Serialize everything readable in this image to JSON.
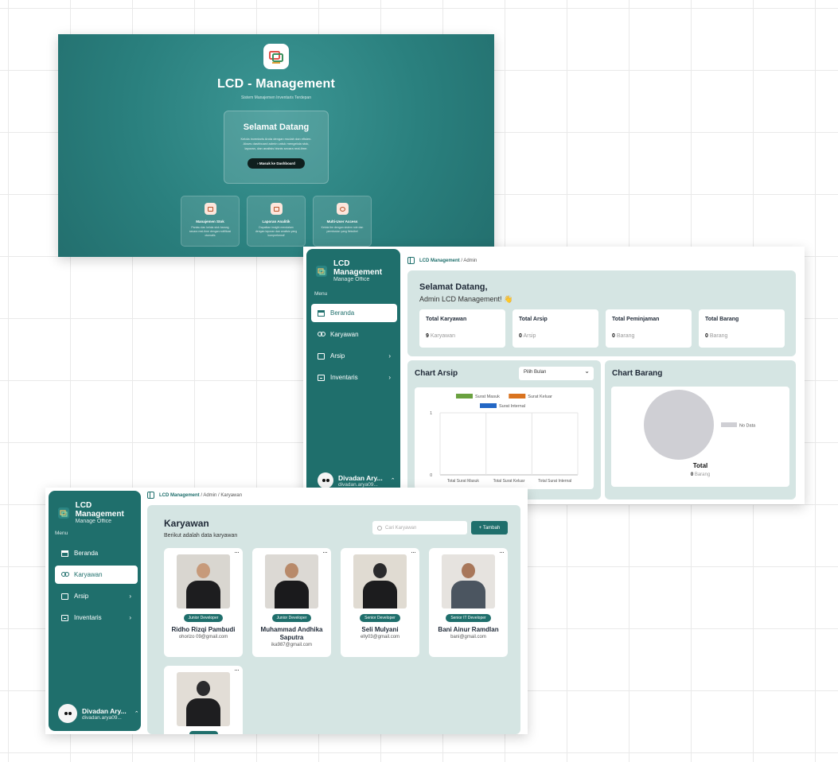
{
  "landing": {
    "title": "LCD - Management",
    "subtitle": "Sistem Manajemen Inventaris Terdepan",
    "welcome_title": "Selamat Datang",
    "welcome_text": "Kelola inventaris Anda dengan mudah dan efisien. Akses dashboard admin untuk mengelola stok, laporan, dan analisis bisnis secara real-time.",
    "cta_label": "Masuk ke Dashboard",
    "features": [
      {
        "title": "Manajemen Stok",
        "text": "Pantau dan kelola stok barang secara real-time dengan notifikasi otomatis"
      },
      {
        "title": "Laporan Analitik",
        "text": "Dapatkan insight mendalam dengan laporan dan analisis yang komprehensif"
      },
      {
        "title": "Multi-User Access",
        "text": "Kelola tim dengan sistem role dan permission yang fleksibel"
      }
    ]
  },
  "sidebar": {
    "app_name": "LCD Management",
    "app_sub": "Manage Office",
    "menu_label": "Menu",
    "items": [
      {
        "label": "Beranda"
      },
      {
        "label": "Karyawan"
      },
      {
        "label": "Arsip"
      },
      {
        "label": "Inventaris"
      }
    ],
    "user_name": "Divadan Ary...",
    "user_email_dash": "divadan.arya09...",
    "user_email_kary": "divadan.arya09..."
  },
  "dashboard": {
    "breadcrumb_root": "LCD Management",
    "breadcrumb_rest": "/ Admin",
    "welcome_line1": "Selamat Datang,",
    "welcome_line2": "Admin LCD Management! 👋",
    "stats": [
      {
        "label": "Total Karyawan",
        "value": "9",
        "unit": "Karyawan"
      },
      {
        "label": "Total Arsip",
        "value": "0",
        "unit": "Arsip"
      },
      {
        "label": "Total Peminjaman",
        "value": "0",
        "unit": "Barang"
      },
      {
        "label": "Total Barang",
        "value": "0",
        "unit": "Barang"
      }
    ],
    "chart_arsip_title": "Chart Arsip",
    "month_select": "Pilih Bulan",
    "chart_barang_title": "Chart Barang",
    "pie_legend": "No Data",
    "pie_total_label": "Total",
    "pie_total_value": "0",
    "pie_total_unit": "Barang"
  },
  "chart_data": [
    {
      "type": "bar",
      "title": "Chart Arsip",
      "categories": [
        "Total Surat Masuk",
        "Total Surat Keluar",
        "Total Surat Internal"
      ],
      "series": [
        {
          "name": "Surat Masuk",
          "color": "#6aa13f",
          "values": [
            0,
            0,
            0
          ]
        },
        {
          "name": "Surat Keluar",
          "color": "#d9731f",
          "values": [
            0,
            0,
            0
          ]
        },
        {
          "name": "Surat Internal",
          "color": "#2367c5",
          "values": [
            0,
            0,
            0
          ]
        }
      ],
      "ylim": [
        0,
        1
      ],
      "yticks": [
        "0",
        "1"
      ],
      "legend": "top"
    },
    {
      "type": "pie",
      "title": "Chart Barang",
      "slices": [
        {
          "label": "No Data",
          "value": 1,
          "color": "#cfcfd4"
        }
      ],
      "legend": "right"
    }
  ],
  "karyawan": {
    "breadcrumb_root": "LCD Management",
    "breadcrumb_rest": "/ Admin / Karyawan",
    "title": "Karyawan",
    "subtitle": "Berikut adalah data karyawan",
    "search_placeholder": "Cari Karyawan",
    "add_label": "+ Tambah",
    "employees": [
      {
        "role": "Junior Developer",
        "name": "Ridho Rizqi Pambudi",
        "email": "ohorizo 09@gmail.com"
      },
      {
        "role": "Junior Developer",
        "name": "Muhammad Andhika Saputra",
        "email": "ika987@gmail.com"
      },
      {
        "role": "Senior Developer",
        "name": "Seli Mulyani",
        "email": "elly03@gmail.com"
      },
      {
        "role": "Senior IT Developer",
        "name": "Bani Ainur Ramdlan",
        "email": "bani@gmail.com"
      },
      {
        "role": "",
        "name": "",
        "email": ""
      }
    ]
  },
  "colors": {
    "primary": "#1f6f6c",
    "panel": "#d5e5e3",
    "landing": "#2a807e"
  }
}
